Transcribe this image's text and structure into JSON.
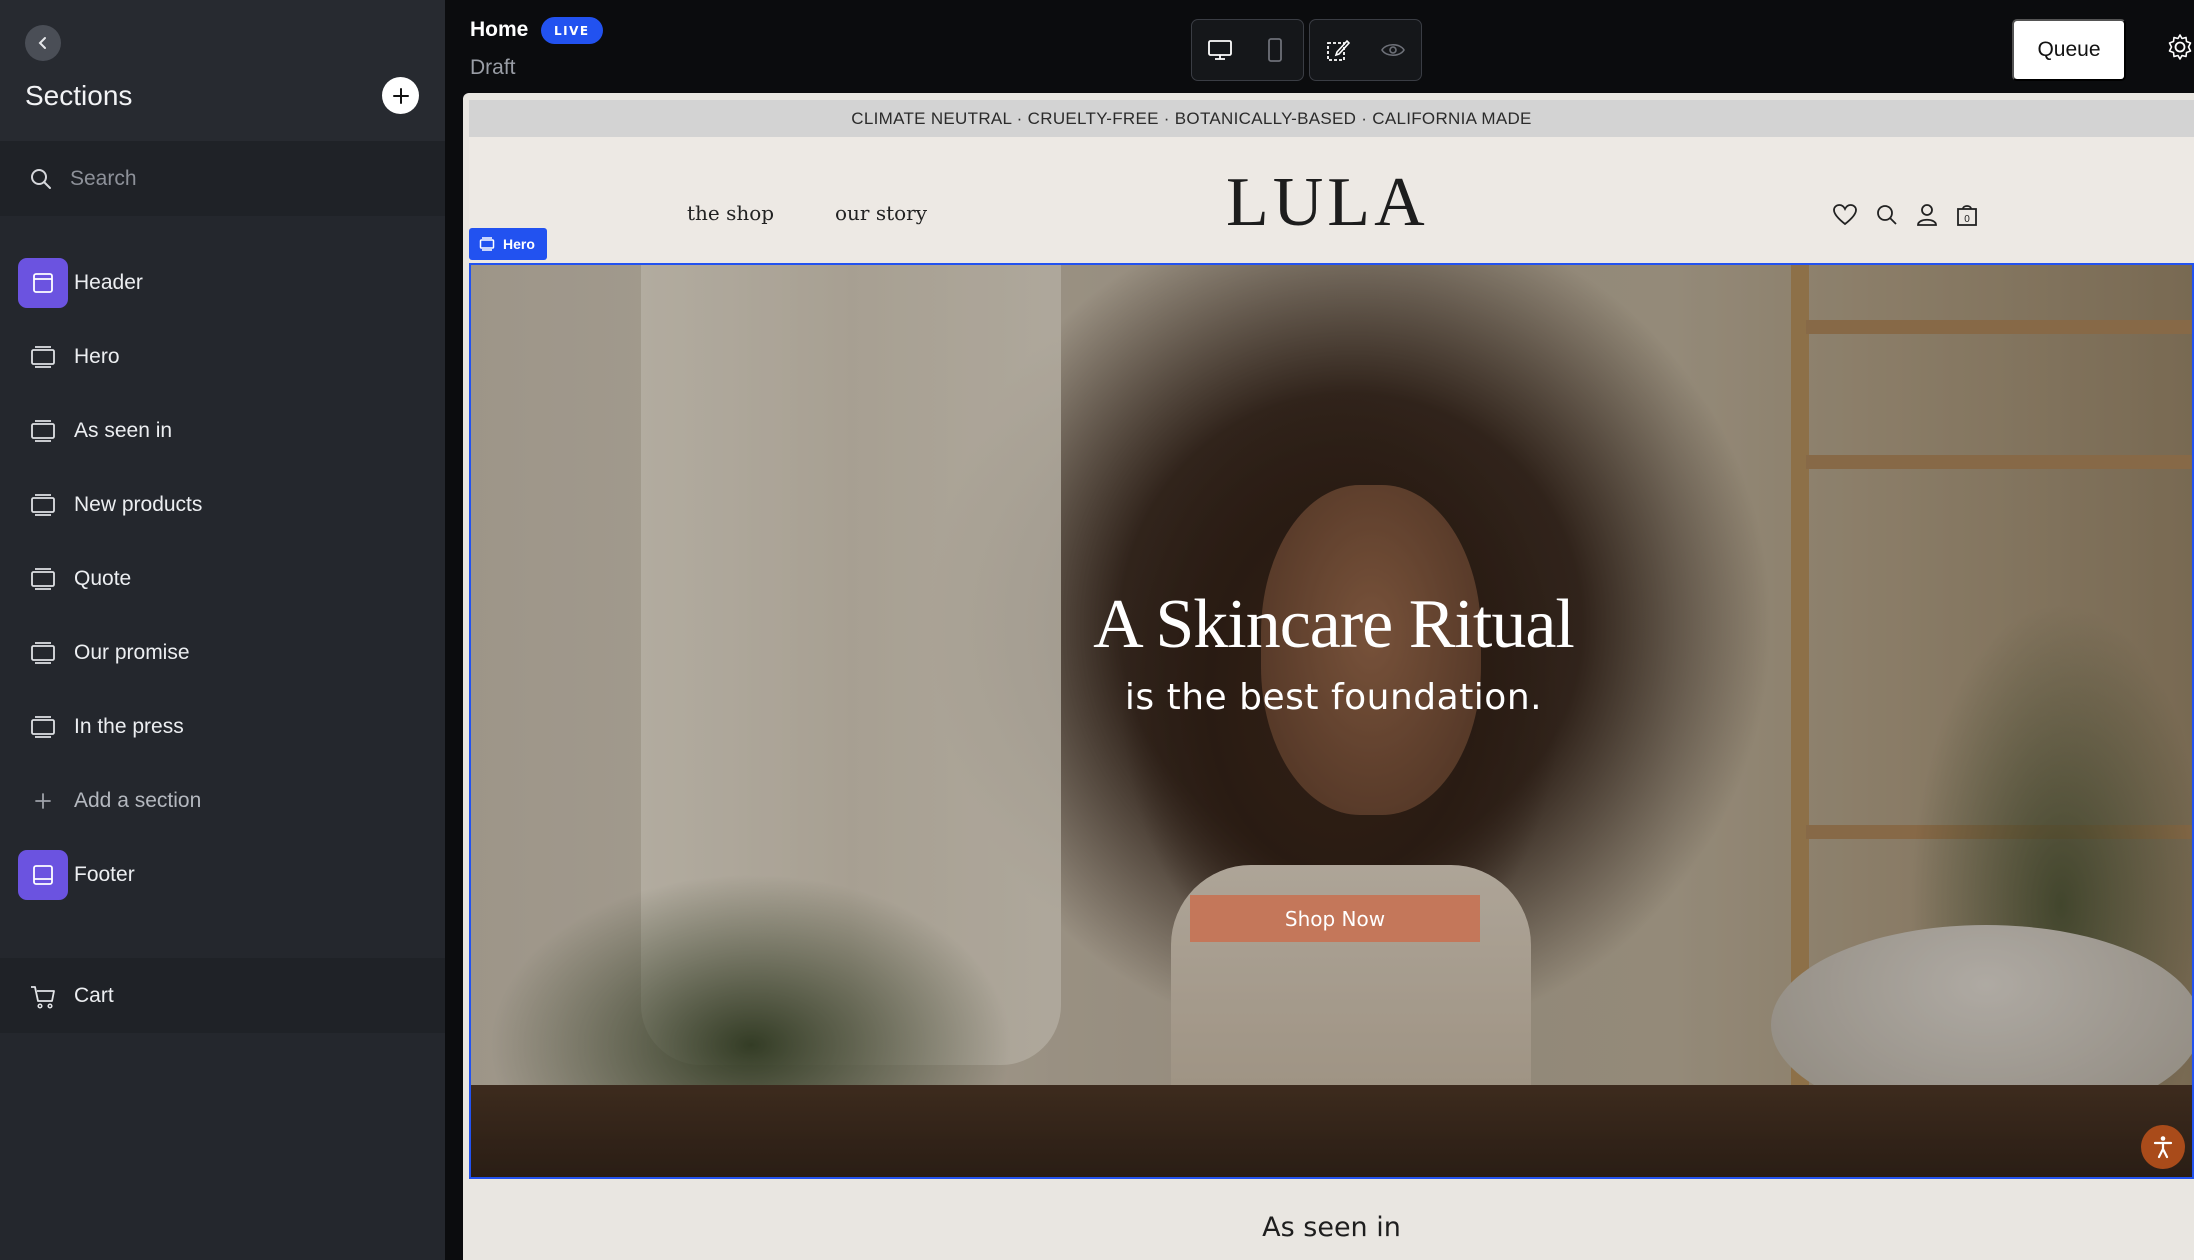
{
  "sidebar": {
    "title": "Sections",
    "search_placeholder": "Search",
    "items": [
      {
        "label": "Header",
        "icon": "header-layout-icon",
        "highlight": true
      },
      {
        "label": "Hero",
        "icon": "section-icon"
      },
      {
        "label": "As seen in",
        "icon": "section-icon"
      },
      {
        "label": "New products",
        "icon": "section-icon"
      },
      {
        "label": "Quote",
        "icon": "section-icon"
      },
      {
        "label": "Our promise",
        "icon": "section-icon"
      },
      {
        "label": "In the press",
        "icon": "section-icon"
      },
      {
        "label": "Add a section",
        "icon": "plus-icon"
      },
      {
        "label": "Footer",
        "icon": "footer-layout-icon",
        "highlight": true
      }
    ],
    "cart_label": "Cart"
  },
  "topbar": {
    "page_name": "Home",
    "live_badge": "LIVE",
    "draft_label": "Draft",
    "queue_label": "Queue"
  },
  "site": {
    "announcement": "CLIMATE NEUTRAL · CRUELTY-FREE · BOTANICALLY-BASED · CALIFORNIA MADE",
    "nav": [
      "the shop",
      "our story"
    ],
    "logo": "LULA",
    "hero_tag": "Hero",
    "hero_title": "A Skincare Ritual",
    "hero_subtitle": "is the best foundation.",
    "cta": "Shop Now",
    "next_section_title": "As seen in",
    "cart_count": "0"
  },
  "colors": {
    "accent_blue": "#2252f0",
    "purple_icon": "#6b53e0",
    "cta": "#c4775a"
  }
}
